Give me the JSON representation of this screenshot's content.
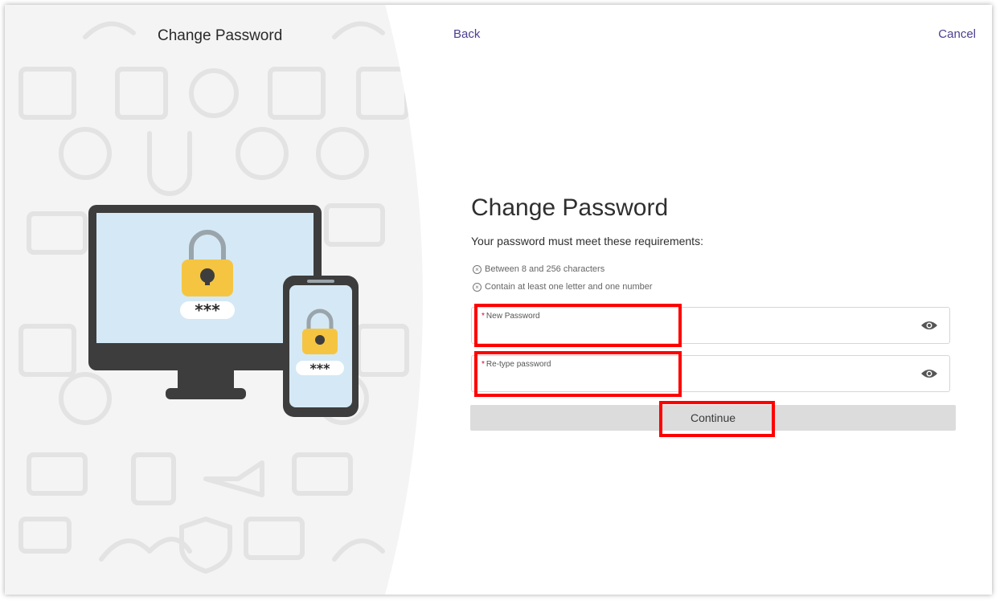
{
  "left_panel": {
    "title": "Change Password"
  },
  "nav": {
    "back_label": "Back",
    "cancel_label": "Cancel"
  },
  "form": {
    "title": "Change Password",
    "requirements_heading": "Your password must meet these requirements:",
    "requirements": [
      "Between 8 and 256 characters",
      "Contain at least one letter and one number"
    ],
    "new_password_label": "New Password",
    "new_password_value": "",
    "retype_password_label": "Re-type password",
    "retype_password_value": "",
    "required_marker": "*",
    "continue_label": "Continue"
  },
  "illustration": {
    "monitor_mask": "***",
    "phone_mask": "***"
  },
  "icons": {
    "eye": "eye-icon",
    "requirement": "circle-x-icon",
    "lock": "padlock-icon"
  },
  "colors": {
    "link": "#4b3f8f",
    "required_star": "#d0021b",
    "annotation": "#ff0000",
    "button_bg": "#dcdcdc",
    "lock": "#f5c542"
  }
}
